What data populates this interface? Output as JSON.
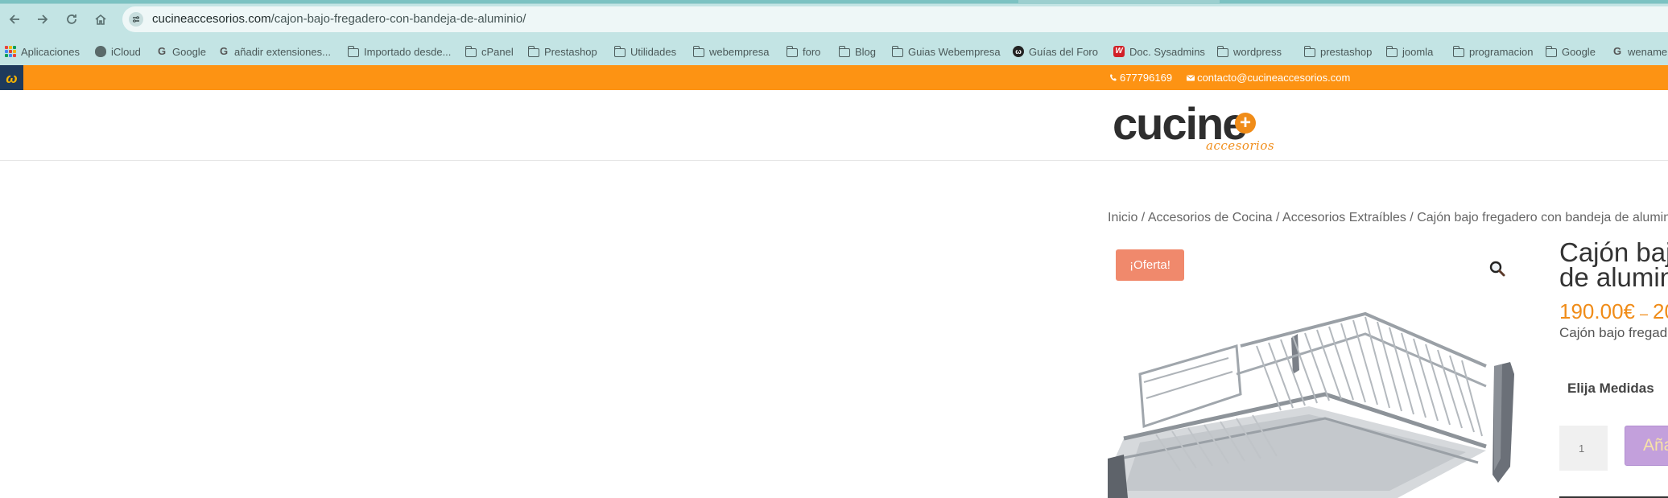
{
  "browser": {
    "url_domain": "cucineaccesorios.com",
    "url_path": "/cajon-bajo-fregadero-con-bandeja-de-aluminio/",
    "bookmarks": [
      {
        "label": "Aplicaciones",
        "icon": "apps-grid-icon"
      },
      {
        "label": "iCloud",
        "icon": "apple-icon"
      },
      {
        "label": "Google",
        "icon": "google-icon"
      },
      {
        "label": "añadir extensiones...",
        "icon": "google-icon"
      },
      {
        "label": "Importado desde...",
        "icon": "folder-icon"
      },
      {
        "label": "cPanel",
        "icon": "folder-icon"
      },
      {
        "label": "Prestashop",
        "icon": "folder-icon"
      },
      {
        "label": "Utilidades",
        "icon": "folder-icon"
      },
      {
        "label": "webempresa",
        "icon": "folder-icon"
      },
      {
        "label": "foro",
        "icon": "folder-icon"
      },
      {
        "label": "Blog",
        "icon": "folder-icon"
      },
      {
        "label": "Guias Webempresa",
        "icon": "folder-icon"
      },
      {
        "label": "Guías del Foro",
        "icon": "webempresa-icon"
      },
      {
        "label": "Doc. Sysadmins",
        "icon": "w-red-icon"
      },
      {
        "label": "wordpress",
        "icon": "folder-icon"
      },
      {
        "label": "prestashop",
        "icon": "folder-icon"
      },
      {
        "label": "joomla",
        "icon": "folder-icon"
      },
      {
        "label": "programacion",
        "icon": "folder-icon"
      },
      {
        "label": "Google",
        "icon": "folder-icon"
      },
      {
        "label": "wename",
        "icon": "google-icon"
      }
    ]
  },
  "topbar": {
    "badge_letter": "ω",
    "phone": "677796169",
    "email": "contacto@cucineaccesorios.com"
  },
  "logo": {
    "word": "cucine",
    "plus": "+",
    "sub": "accesorios"
  },
  "breadcrumb": {
    "items": [
      "Inicio",
      "Accesorios de Cocina",
      "Accesorios Extraíbles"
    ],
    "current": "Cajón bajo fregadero con bandeja de aluminio",
    "separator": " / "
  },
  "product": {
    "sale_badge": "¡Oferta!",
    "title_line1": "Cajón baj",
    "title_line2": "de alumin",
    "price_from": "190.00€",
    "price_sep": "–",
    "price_to": "20",
    "short_desc": "Cajón bajo fregad",
    "variation_label": "Elija Medidas",
    "qty_value": "1",
    "add_button": "Aña"
  },
  "colors": {
    "browser_chrome": "#c3e4e4",
    "topbar_orange": "#fd9313",
    "price_orange": "#f08c18",
    "sale_badge": "#f0896c",
    "add_button": "#c3a0dc"
  }
}
